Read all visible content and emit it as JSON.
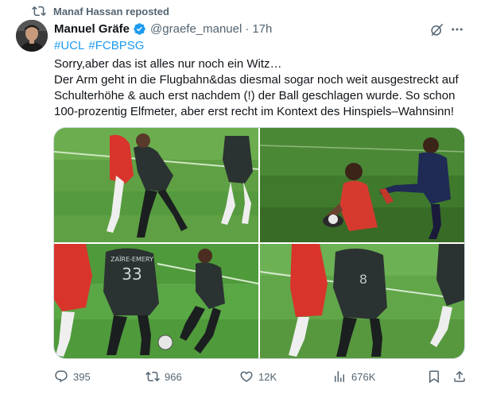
{
  "repost": {
    "text": "Manaf Hassan reposted",
    "icon": "repost-icon"
  },
  "author": {
    "name": "Manuel Gräfe",
    "handle": "@graefe_manuel",
    "separator": "·",
    "time": "17h",
    "verified": true
  },
  "header_icons": [
    "grok-icon",
    "more-icon"
  ],
  "hashtags": [
    "#UCL",
    "#FCBPSG"
  ],
  "body_lines": [
    "Sorry,aber das ist alles nur noch ein Witz…",
    "Der Arm geht in die Flugbahn&das diesmal sogar noch weit ausgestreckt auf",
    "Schulterhöhe & auch erst nachdem (!) der Ball geschlagen wurde. So schon",
    "100-prozentig Elfmeter, aber erst recht im Kontext des Hinspiels–Wahnsinn!"
  ],
  "media": {
    "tiles": [
      {
        "description": "replay still 1"
      },
      {
        "description": "replay still 2"
      },
      {
        "description": "replay still 3",
        "jersey_text": "ZAÏRE-EMERY",
        "jersey_number": "33"
      },
      {
        "description": "replay still 4"
      }
    ]
  },
  "actions": {
    "replies": "395",
    "reposts": "966",
    "likes": "12K",
    "views": "676K"
  },
  "colors": {
    "accent": "#1d9bf0",
    "secondary_text": "#536471",
    "border": "#cfd9de"
  }
}
